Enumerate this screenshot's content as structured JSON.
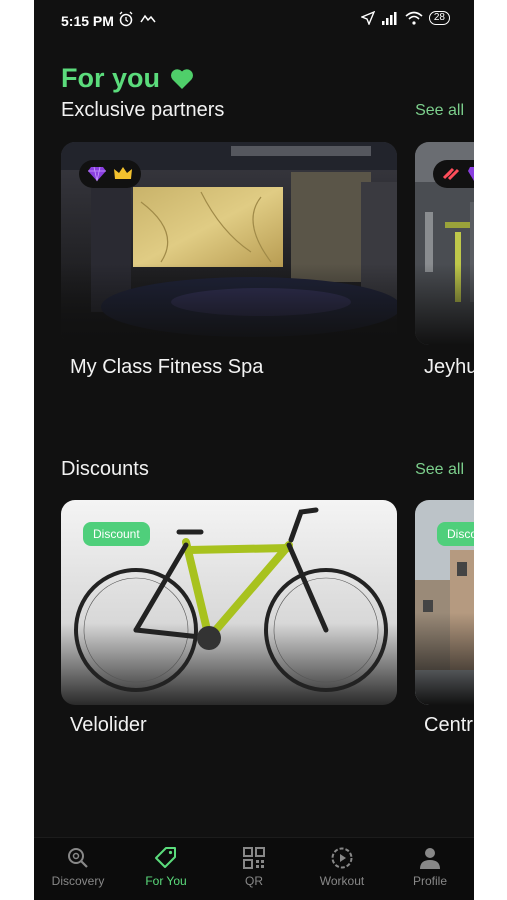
{
  "status": {
    "time": "5:15 PM",
    "battery": "28"
  },
  "hero": {
    "title": "For you"
  },
  "partners": {
    "title": "Exclusive partners",
    "see_all": "See all",
    "items": [
      {
        "name": "My Class Fitness Spa"
      },
      {
        "name": "Jeyhu"
      }
    ]
  },
  "discounts": {
    "title": "Discounts",
    "see_all": "See all",
    "items": [
      {
        "name": "Velolider",
        "badge": "Discount"
      },
      {
        "name": "Centr",
        "badge": "Disco"
      }
    ]
  },
  "tabs": [
    {
      "label": "Discovery",
      "icon": "search-icon"
    },
    {
      "label": "For You",
      "icon": "tag-icon",
      "active": true
    },
    {
      "label": "QR",
      "icon": "qr-icon"
    },
    {
      "label": "Workout",
      "icon": "play-icon"
    },
    {
      "label": "Profile",
      "icon": "person-icon"
    }
  ],
  "colors": {
    "accent": "#5bdc7c",
    "background": "#111111"
  }
}
